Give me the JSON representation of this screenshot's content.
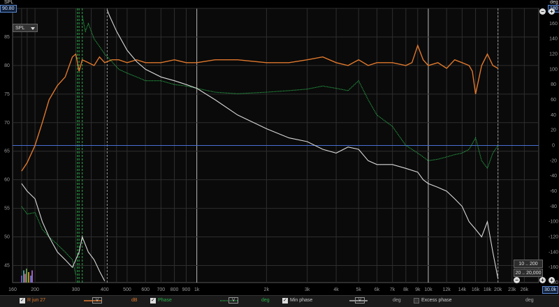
{
  "corner": {
    "left_unit": "SPL",
    "left_value": "90.80",
    "right_unit": "deg",
    "right_value": "180",
    "x_value": "30.0k"
  },
  "spl_dropdown": "SPL",
  "buttons": {
    "range1": "10 .. 200",
    "range2": "20 .. 20,000"
  },
  "y_left_ticks": [
    "90",
    "85",
    "80",
    "75",
    "70",
    "65",
    "60",
    "55",
    "50",
    "45"
  ],
  "y_right_ticks": [
    "180",
    "160",
    "140",
    "120",
    "100",
    "80",
    "60",
    "40",
    "20",
    "0",
    "-20",
    "-40",
    "-60",
    "-80",
    "-100",
    "-120",
    "-140",
    "-160",
    "-180"
  ],
  "x_ticks": [
    "160",
    "200",
    "300",
    "400",
    "500",
    "600",
    "700",
    "800",
    "900",
    "1k",
    "2k",
    "3k",
    "4k",
    "5k",
    "6k",
    "7k",
    "8k",
    "9k",
    "10k",
    "12k",
    "14k",
    "16k",
    "18k",
    "20k",
    "23k",
    "26k",
    "30k"
  ],
  "legend": {
    "trace_name": "R jun 27",
    "trace_unit": "dB",
    "phase_label": "Phase",
    "phase_unit": "deg",
    "min_phase_label": "Min phase",
    "min_phase_unit": "deg",
    "excess_phase_label": "Excess phase",
    "excess_phase_unit": "deg",
    "v_symbol": "V",
    "check": "✓"
  },
  "colors": {
    "spl": "#e0782c",
    "phase": "#29b04a",
    "min_phase": "#d8d8d8",
    "reference_line": "#4a6fd6"
  },
  "chart_data": {
    "type": "line",
    "xscale": "log",
    "xlim": [
      160,
      30000
    ],
    "ylim_left": [
      42,
      90
    ],
    "ylim_right": [
      -180,
      180
    ],
    "reference_line_deg": 0,
    "vertical_markers_hz": [
      305,
      310,
      320,
      410,
      20000
    ],
    "series": [
      {
        "axis": "left",
        "x": [
          175,
          185,
          200,
          215,
          230,
          250,
          270,
          290,
          300,
          310,
          320,
          340,
          360,
          380,
          400,
          430,
          460,
          500,
          550,
          600,
          700,
          800,
          900,
          1000,
          1200,
          1500,
          2000,
          2500,
          3000,
          3500,
          4000,
          4500,
          5000,
          5500,
          6000,
          7000,
          8000,
          8500,
          9000,
          9500,
          10000,
          11000,
          12000,
          13000,
          14000,
          15000,
          15500,
          16000,
          17000,
          18000,
          19000,
          20000
        ],
        "y": [
          61.5,
          63,
          66,
          70,
          74,
          76.5,
          78,
          81.5,
          82,
          79,
          81,
          80.5,
          80,
          81.5,
          80.5,
          81,
          81,
          80.5,
          81,
          80.5,
          80.5,
          81,
          80.5,
          80.5,
          81,
          81,
          80.5,
          80.5,
          81,
          81.5,
          80.5,
          80,
          81,
          80,
          80.5,
          80.5,
          80,
          80.5,
          83.5,
          81,
          80,
          80.5,
          79.5,
          81,
          80.5,
          80,
          79,
          75,
          80,
          82,
          80,
          79.5
        ]
      },
      {
        "axis": "right",
        "x": [
          175,
          185,
          200,
          215,
          230,
          250,
          270,
          290,
          300,
          305,
          310,
          320,
          330,
          340,
          360,
          380,
          400,
          430,
          460,
          500,
          550,
          600,
          700,
          800,
          900,
          1000,
          1200,
          1500,
          2000,
          2500,
          3000,
          3500,
          4000,
          4500,
          5000,
          5500,
          6000,
          7000,
          8000,
          8500,
          9000,
          9500,
          10000,
          11000,
          12000,
          13000,
          14000,
          15000,
          16000,
          17000,
          18000,
          19000,
          20000
        ],
        "y": [
          -80,
          -90,
          -88,
          -110,
          -120,
          -130,
          -140,
          -150,
          -170,
          175,
          -175,
          170,
          150,
          160,
          140,
          130,
          120,
          110,
          100,
          95,
          90,
          85,
          85,
          80,
          78,
          75,
          70,
          68,
          70,
          72,
          74,
          78,
          75,
          72,
          85,
          60,
          40,
          25,
          0,
          -5,
          -10,
          -15,
          -20,
          -18,
          -15,
          -12,
          -10,
          -5,
          10,
          -20,
          -30,
          -10,
          0
        ]
      },
      {
        "axis": "right",
        "x": [
          175,
          185,
          200,
          215,
          230,
          250,
          270,
          290,
          300,
          310,
          320,
          340,
          360,
          380,
          400,
          410,
          420,
          450,
          500,
          550,
          600,
          700,
          800,
          900,
          1000,
          1200,
          1500,
          2000,
          2500,
          3000,
          3500,
          4000,
          4500,
          5000,
          5500,
          6000,
          7000,
          8000,
          9000,
          9500,
          10000,
          11000,
          12000,
          13000,
          14000,
          15000,
          16000,
          17000,
          18000,
          19000,
          20000
        ],
        "y": [
          -50,
          -60,
          -70,
          -100,
          -120,
          -140,
          -150,
          -160,
          -150,
          -140,
          -120,
          -140,
          -150,
          -165,
          -178,
          178,
          170,
          150,
          125,
          110,
          100,
          90,
          85,
          80,
          75,
          60,
          40,
          22,
          10,
          5,
          -5,
          -10,
          -2,
          -5,
          -20,
          -25,
          -25,
          -30,
          -35,
          -45,
          -50,
          -55,
          -60,
          -70,
          -80,
          -100,
          -110,
          -120,
          -100,
          -140,
          -175
        ]
      }
    ]
  }
}
